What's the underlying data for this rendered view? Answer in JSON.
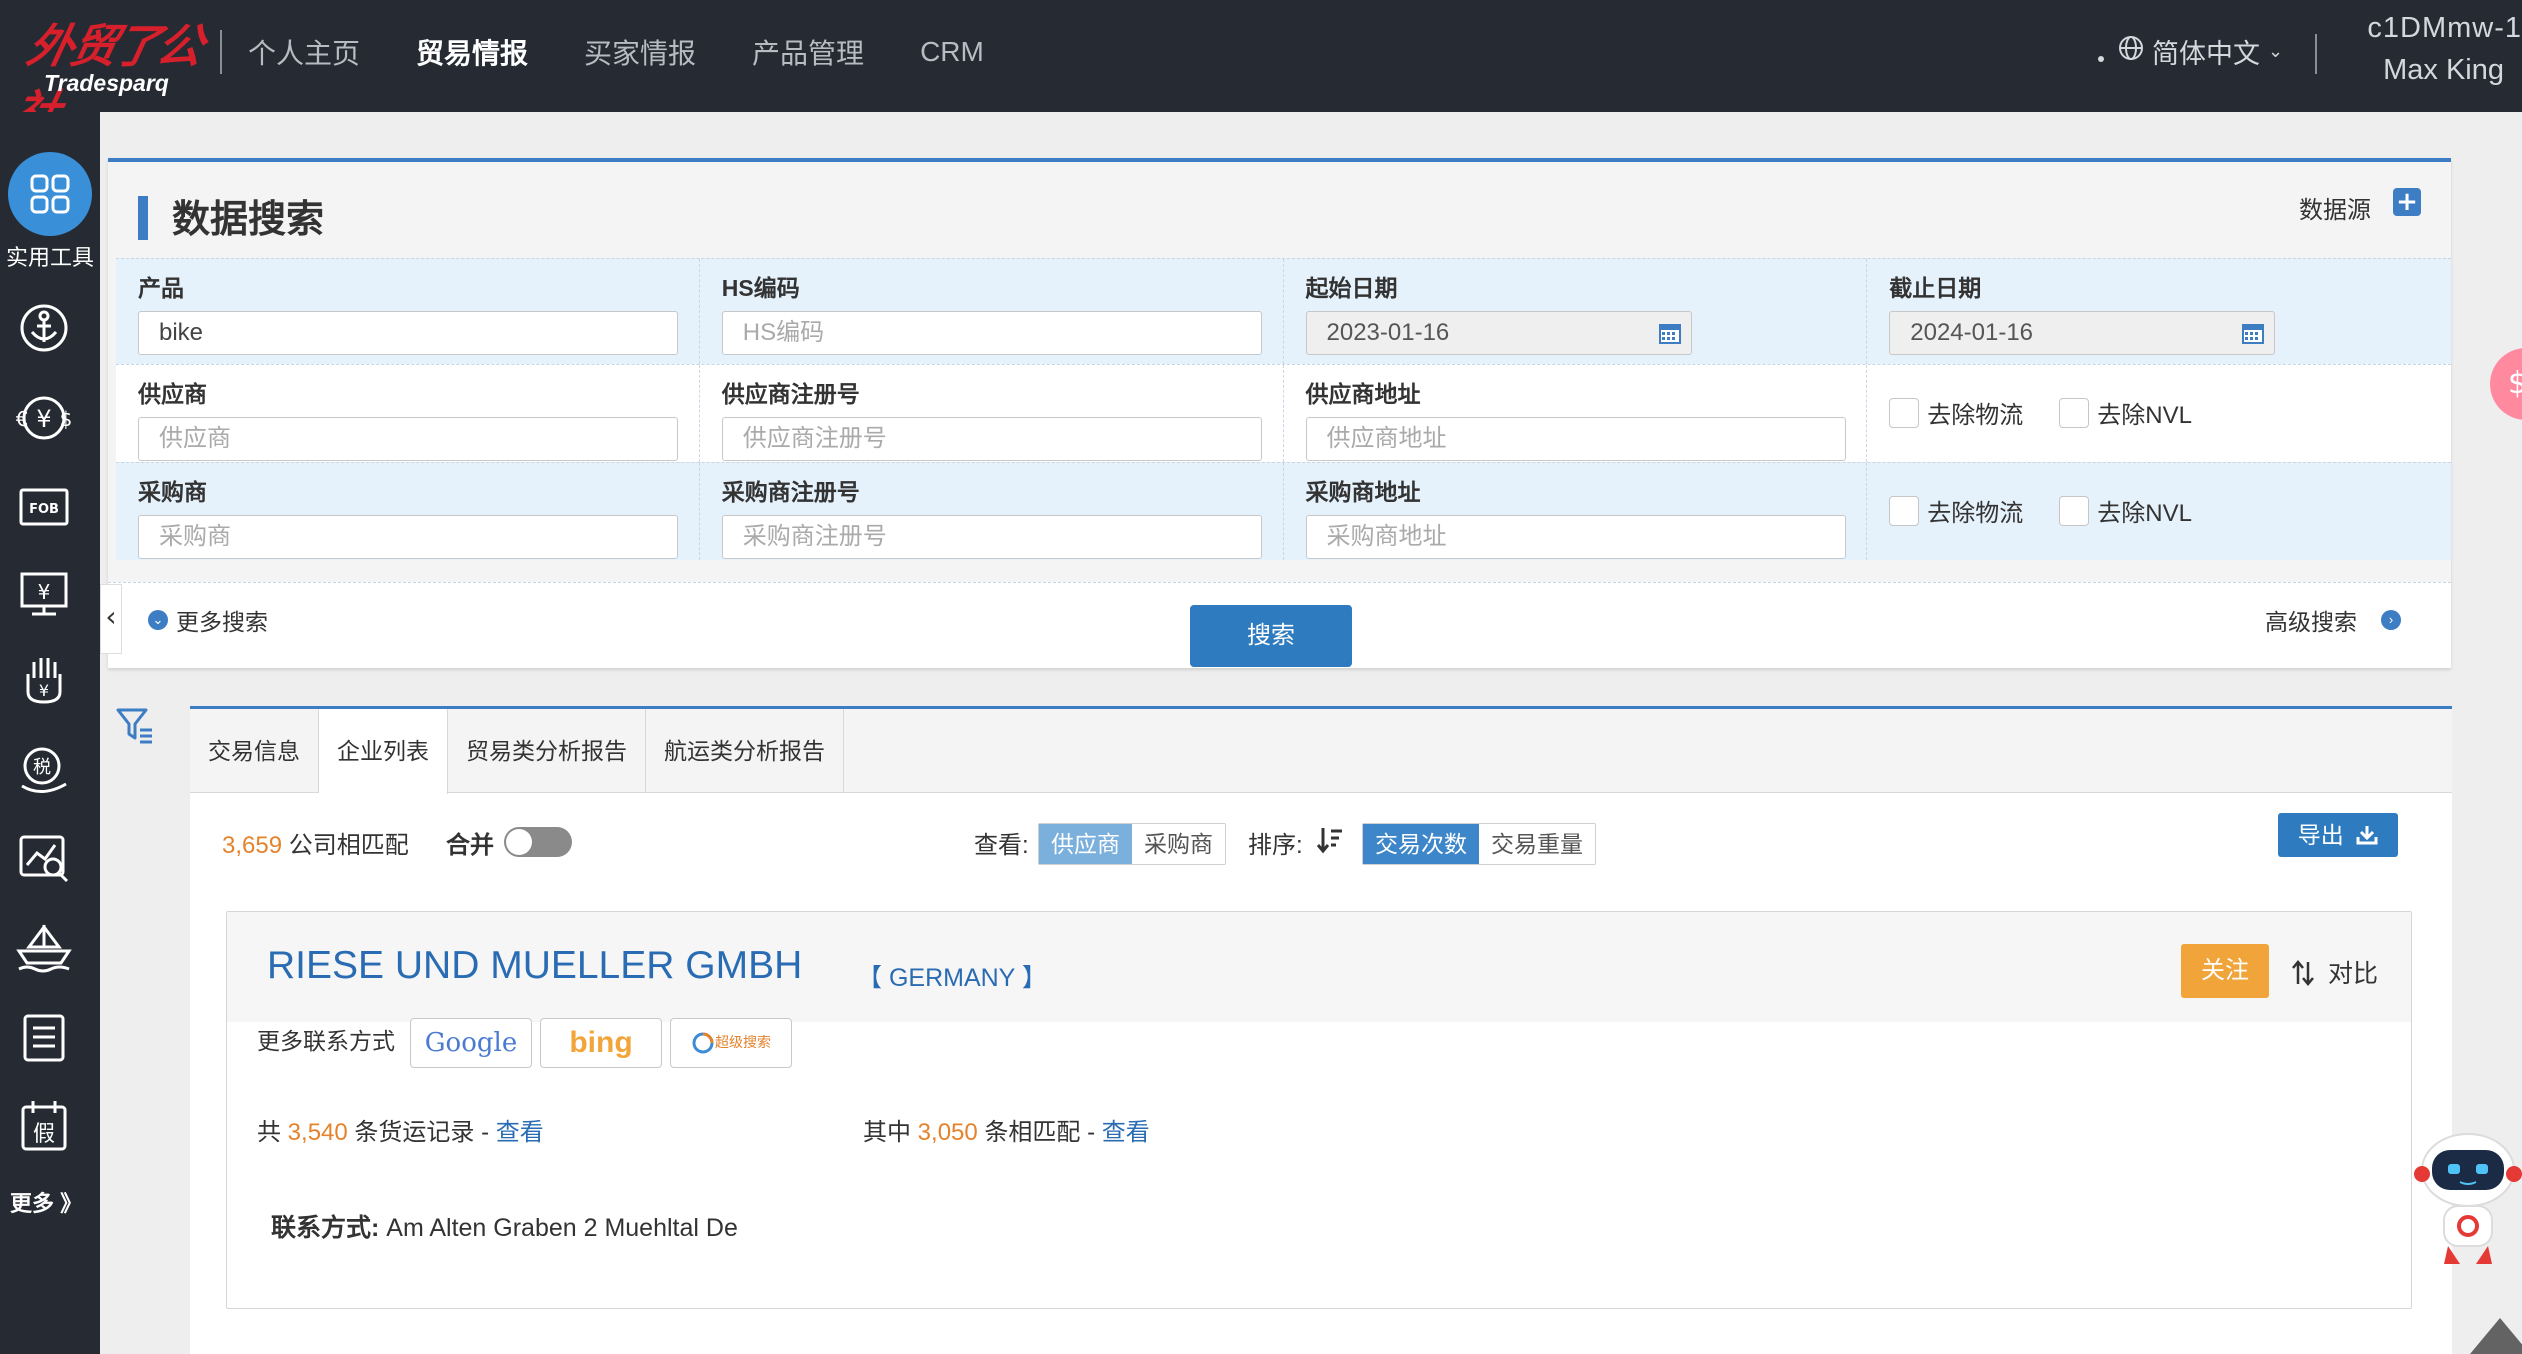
{
  "header": {
    "logo_text": "外贸了公社",
    "logo_sub": "Tradesparq",
    "nav": [
      "个人主页",
      "贸易情报",
      "买家情报",
      "产品管理",
      "CRM"
    ],
    "active_nav": "贸易情报",
    "language": "简体中文",
    "user_id": "c1DMmw-1",
    "user_name": "Max King"
  },
  "sidebar": {
    "tools_label": "实用工具",
    "icons": [
      "anchor-icon",
      "currency-exchange-icon",
      "fob-icon",
      "price-monitor-icon",
      "hand-yuan-icon",
      "tax-icon",
      "chart-search-icon",
      "ship-icon",
      "document-icon",
      "holiday-calendar-icon"
    ],
    "fob_text": "FOB",
    "holiday_text": "假",
    "more_label": "更多 》"
  },
  "search_panel": {
    "title": "数据搜索",
    "datasource_label": "数据源",
    "fields": {
      "product": {
        "label": "产品",
        "value": "bike"
      },
      "hs_code": {
        "label": "HS编码",
        "placeholder": "HS编码"
      },
      "start_date": {
        "label": "起始日期",
        "value": "2023-01-16"
      },
      "end_date": {
        "label": "截止日期",
        "value": "2024-01-16"
      },
      "supplier": {
        "label": "供应商",
        "placeholder": "供应商"
      },
      "supplier_reg": {
        "label": "供应商注册号",
        "placeholder": "供应商注册号"
      },
      "supplier_addr": {
        "label": "供应商地址",
        "placeholder": "供应商地址"
      },
      "buyer": {
        "label": "采购商",
        "placeholder": "采购商"
      },
      "buyer_reg": {
        "label": "采购商注册号",
        "placeholder": "采购商注册号"
      },
      "buyer_addr": {
        "label": "采购商地址",
        "placeholder": "采购商地址"
      }
    },
    "checkbox_logistics": "去除物流",
    "checkbox_nvl": "去除NVL",
    "more_search": "更多搜索",
    "search_button": "搜索",
    "advanced_search": "高级搜索"
  },
  "results": {
    "tabs": [
      "交易信息",
      "企业列表",
      "贸易类分析报告",
      "航运类分析报告"
    ],
    "active_tab": "企业列表",
    "match_count": "3,659",
    "match_suffix": " 公司相匹配",
    "merge_label": "合并",
    "merge_on": false,
    "view_label": "查看:",
    "view_options": [
      "供应商",
      "采购商"
    ],
    "view_selected": "供应商",
    "sort_label": "排序:",
    "sort_options": [
      "交易次数",
      "交易重量"
    ],
    "sort_selected": "交易次数",
    "export_label": "导出"
  },
  "company": {
    "name": "RIESE UND MUELLER GMBH",
    "country": "【 GERMANY 】",
    "follow_label": "关注",
    "compare_label": "对比",
    "more_contact_label": "更多联系方式",
    "engines": [
      "Google",
      "bing",
      "超级搜索"
    ],
    "total_prefix": "共 ",
    "total_records": "3,540",
    "total_suffix": " 条货运记录 - ",
    "view_link": "查看",
    "matched_prefix": "其中 ",
    "matched_records": "3,050",
    "matched_suffix": " 条相匹配 - ",
    "contact_label": "联系方式: ",
    "contact_value": "Am Alten Graben 2 Muehltal De"
  },
  "colors": {
    "topbar": "#262b33",
    "accent_blue": "#3d7dc4",
    "orange": "#e5832c",
    "follow_orange": "#f0a43a"
  }
}
